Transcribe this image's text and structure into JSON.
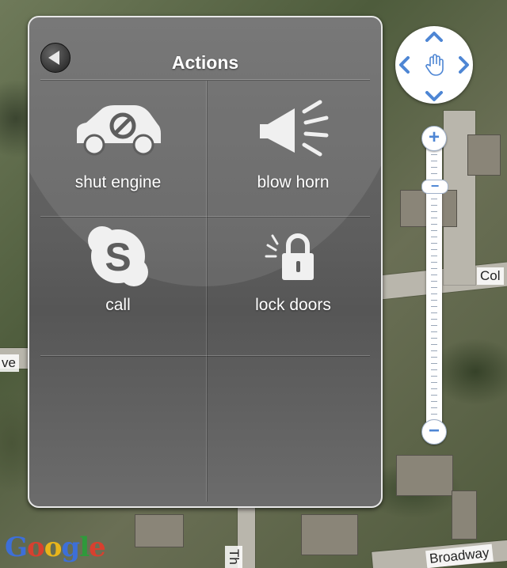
{
  "panel": {
    "title": "Actions",
    "actions": [
      {
        "label": "shut engine",
        "icon": "car-disabled-icon"
      },
      {
        "label": "blow horn",
        "icon": "horn-icon"
      },
      {
        "label": "call",
        "icon": "skype-icon"
      },
      {
        "label": "lock doors",
        "icon": "padlock-icon"
      }
    ]
  },
  "map": {
    "road_labels": [
      "Col",
      "ve",
      "Th",
      "Broadway"
    ],
    "logo": "Google",
    "zoom_in_label": "+",
    "zoom_out_label": "−",
    "zoom_thumb_label": "−"
  },
  "colors": {
    "panel_bg": "#5e5e5e",
    "accent": "#4e86d4"
  }
}
